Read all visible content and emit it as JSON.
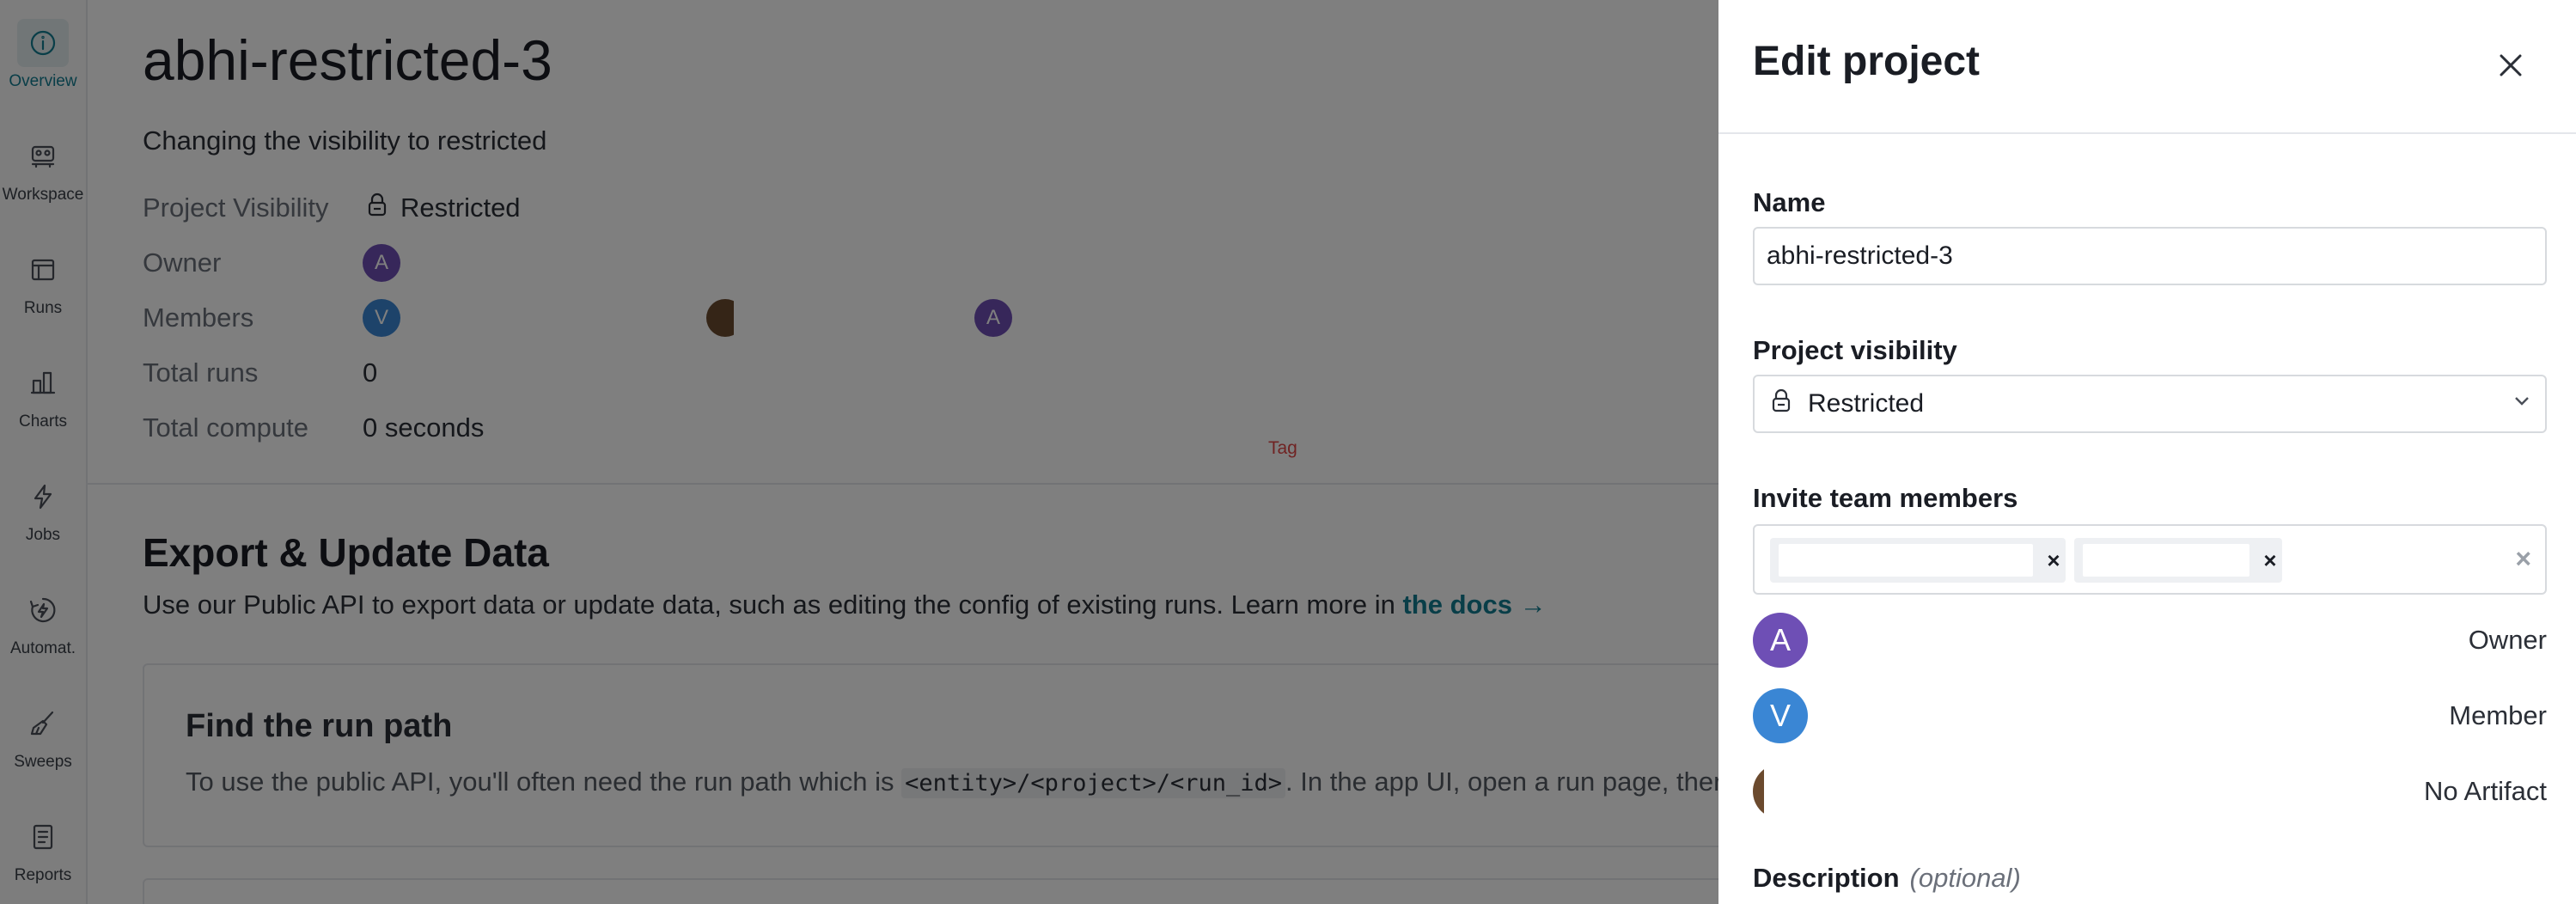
{
  "nav": {
    "items": [
      {
        "label": "Overview",
        "icon": "info-circle-icon",
        "active": true
      },
      {
        "label": "Workspace",
        "icon": "workspace-icon",
        "active": false
      },
      {
        "label": "Runs",
        "icon": "table-icon",
        "active": false
      },
      {
        "label": "Charts",
        "icon": "bar-chart-icon",
        "active": false
      },
      {
        "label": "Jobs",
        "icon": "lightning-icon",
        "active": false
      },
      {
        "label": "Automat.",
        "icon": "automation-icon",
        "active": false
      },
      {
        "label": "Sweeps",
        "icon": "broom-icon",
        "active": false
      },
      {
        "label": "Reports",
        "icon": "document-icon",
        "active": false
      }
    ]
  },
  "project": {
    "title": "abhi-restricted-3",
    "description": "Changing the visibility to restricted",
    "visibility_key": "Project Visibility",
    "visibility_value": "Restricted",
    "owner_key": "Owner",
    "owner_initial": "A",
    "members_key": "Members",
    "member_initials": [
      "V",
      "",
      "A"
    ],
    "total_runs_key": "Total runs",
    "total_runs_value": "0",
    "total_compute_key": "Total compute",
    "total_compute_value": "0 seconds",
    "tag": "Tag"
  },
  "export": {
    "heading": "Export & Update Data",
    "text": "Use our Public API to export data or update data, such as editing the config of existing runs. Learn more in ",
    "link": "the docs →",
    "card_title": "Find the run path",
    "card_text_pre": "To use the public API, you'll often need the run path which is ",
    "card_code": "<entity>/<project>/<run_id>",
    "card_text_post": ". In the app UI, open a run page, then c"
  },
  "drawer": {
    "title": "Edit project",
    "name_label": "Name",
    "name_value": "abhi-restricted-3",
    "visibility_label": "Project visibility",
    "visibility_value": "Restricted",
    "invite_label": "Invite team members",
    "chip_remove": "×",
    "clear_all": "×",
    "members": [
      {
        "initial": "A",
        "role": "Owner",
        "color": "#6e4fb5"
      },
      {
        "initial": "V",
        "role": "Member",
        "color": "#3a86d4"
      },
      {
        "initial": "",
        "role": "No Artifact",
        "color": "#6b4a2e"
      }
    ],
    "description_label": "Description",
    "description_optional": "(optional)"
  },
  "colors": {
    "accent": "#127c91",
    "owner_avatar": "#6e4fb5",
    "member_avatar_v": "#3a86d4",
    "tag": "#e04646"
  }
}
